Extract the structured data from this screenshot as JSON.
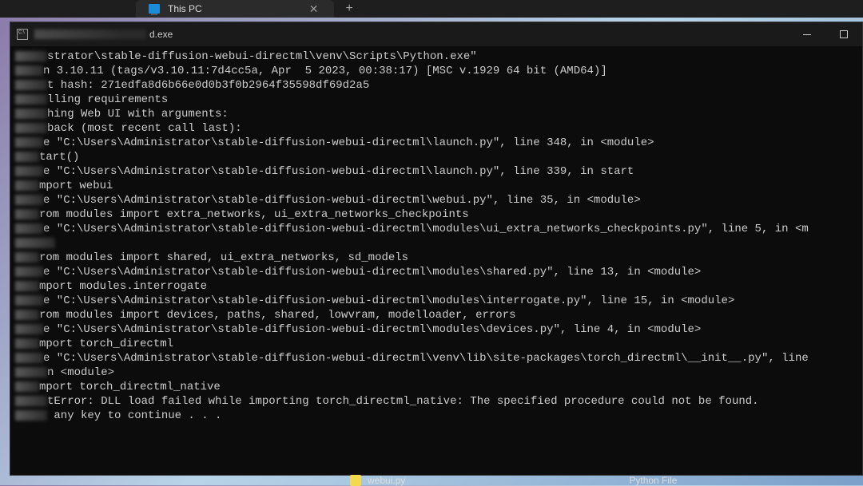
{
  "explorer": {
    "tab_title": "This PC"
  },
  "cmd": {
    "title_suffix": "d.exe",
    "full_title_hint": "C:\\Windows\\system32\\cmd.exe"
  },
  "terminal": {
    "lines": [
      "strator\\stable-diffusion-webui-directml\\venv\\Scripts\\Python.exe\"",
      "n 3.10.11 (tags/v3.10.11:7d4cc5a, Apr  5 2023, 00:38:17) [MSC v.1929 64 bit (AMD64)]",
      "t hash: 271edfa8d6b66e0d0b3f0b2964f35598df69d2a5",
      "lling requirements",
      "hing Web UI with arguments:",
      "back (most recent call last):",
      "e \"C:\\Users\\Administrator\\stable-diffusion-webui-directml\\launch.py\", line 348, in <module>",
      "tart()",
      "e \"C:\\Users\\Administrator\\stable-diffusion-webui-directml\\launch.py\", line 339, in start",
      "mport webui",
      "e \"C:\\Users\\Administrator\\stable-diffusion-webui-directml\\webui.py\", line 35, in <module>",
      "rom modules import extra_networks, ui_extra_networks_checkpoints",
      "e \"C:\\Users\\Administrator\\stable-diffusion-webui-directml\\modules\\ui_extra_networks_checkpoints.py\", line 5, in <m",
      "",
      "rom modules import shared, ui_extra_networks, sd_models",
      "e \"C:\\Users\\Administrator\\stable-diffusion-webui-directml\\modules\\shared.py\", line 13, in <module>",
      "mport modules.interrogate",
      "e \"C:\\Users\\Administrator\\stable-diffusion-webui-directml\\modules\\interrogate.py\", line 15, in <module>",
      "rom modules import devices, paths, shared, lowvram, modelloader, errors",
      "e \"C:\\Users\\Administrator\\stable-diffusion-webui-directml\\modules\\devices.py\", line 4, in <module>",
      "mport torch_directml",
      "e \"C:\\Users\\Administrator\\stable-diffusion-webui-directml\\venv\\lib\\site-packages\\torch_directml\\__init__.py\", line",
      "n <module>",
      "mport torch_directml_native",
      "tError: DLL load failed while importing torch_directml_native: The specified procedure could not be found.",
      " any key to continue . . ."
    ],
    "prefixes": [
      "venv \"C:\\Users\\Admini",
      "Pytho",
      "Commi",
      "Insta",
      "Launc",
      "Trace",
      "  Fil",
      "    s",
      "  Fil",
      "    i",
      "  Fil",
      "    f",
      "  Fil",
      "odule>",
      "    f",
      "  Fil",
      "    i",
      "  Fil",
      "    f",
      "  Fil",
      "    i",
      "  Fil",
      " 14, i",
      "    i",
      "Impor",
      "Press"
    ]
  },
  "file_explorer_row": {
    "filename": "webui.py",
    "type": "Python File"
  }
}
